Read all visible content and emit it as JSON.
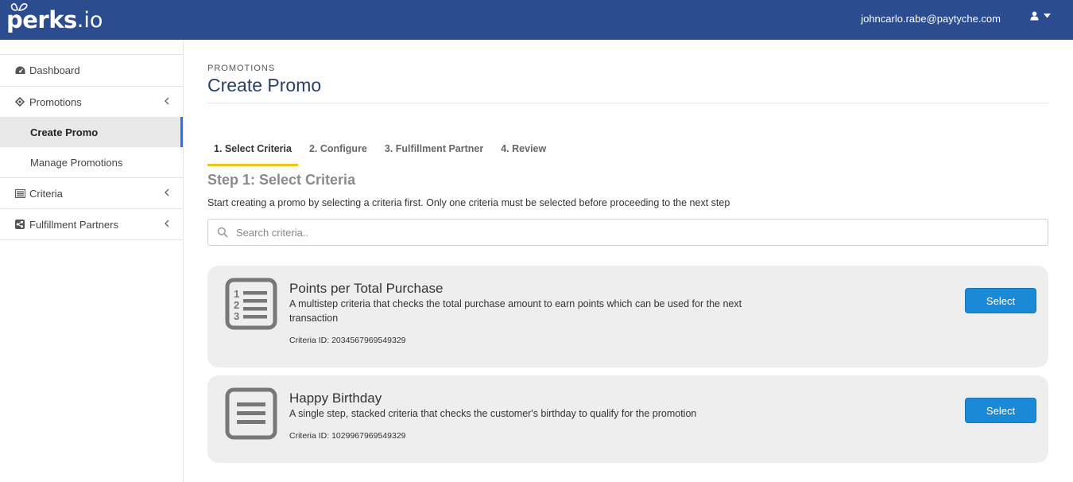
{
  "brand": {
    "logo_main": "perks",
    "logo_suffix": ".io",
    "topbar_color": "#2b4c8f"
  },
  "header": {
    "user_email": "johncarlo.rabe@paytyche.com",
    "user_icon": "user-icon",
    "caret_icon": "caret-down-icon"
  },
  "sidebar": {
    "dashboard": "Dashboard",
    "promotions": "Promotions",
    "create_promo": "Create Promo",
    "manage_promotions": "Manage Promotions",
    "criteria": "Criteria",
    "fulfillment_partners": "Fulfillment Partners",
    "active_indicator_color": "#2f6fe4"
  },
  "page": {
    "breadcrumb": "PROMOTIONS",
    "title": "Create Promo"
  },
  "wizard": {
    "tabs": [
      {
        "label": "1. Select Criteria",
        "active": true
      },
      {
        "label": "2. Configure",
        "active": false
      },
      {
        "label": "3. Fulfillment Partner",
        "active": false
      },
      {
        "label": "4. Review",
        "active": false
      }
    ],
    "active_tab_color": "#f0c419",
    "step_title": "Step 1: Select Criteria",
    "step_description": "Start creating a promo by selecting a criteria first. Only one criteria must be selected before proceeding to the next step"
  },
  "search": {
    "placeholder": "Search criteria..",
    "value": ""
  },
  "criteria": [
    {
      "title": "Points per Total Purchase",
      "description": "A multistep criteria that checks the total purchase amount to earn points which can be used for the next transaction",
      "id_text": "Criteria ID: 2034567969549329",
      "icon": "numbered-list-icon",
      "button": "Select"
    },
    {
      "title": "Happy Birthday",
      "description": "A single step, stacked criteria that checks the customer's birthday to qualify for the promotion",
      "id_text": "Criteria ID: 1029967969549329",
      "icon": "stacked-list-icon",
      "button": "Select"
    }
  ],
  "button_color": "#1a8ad6"
}
